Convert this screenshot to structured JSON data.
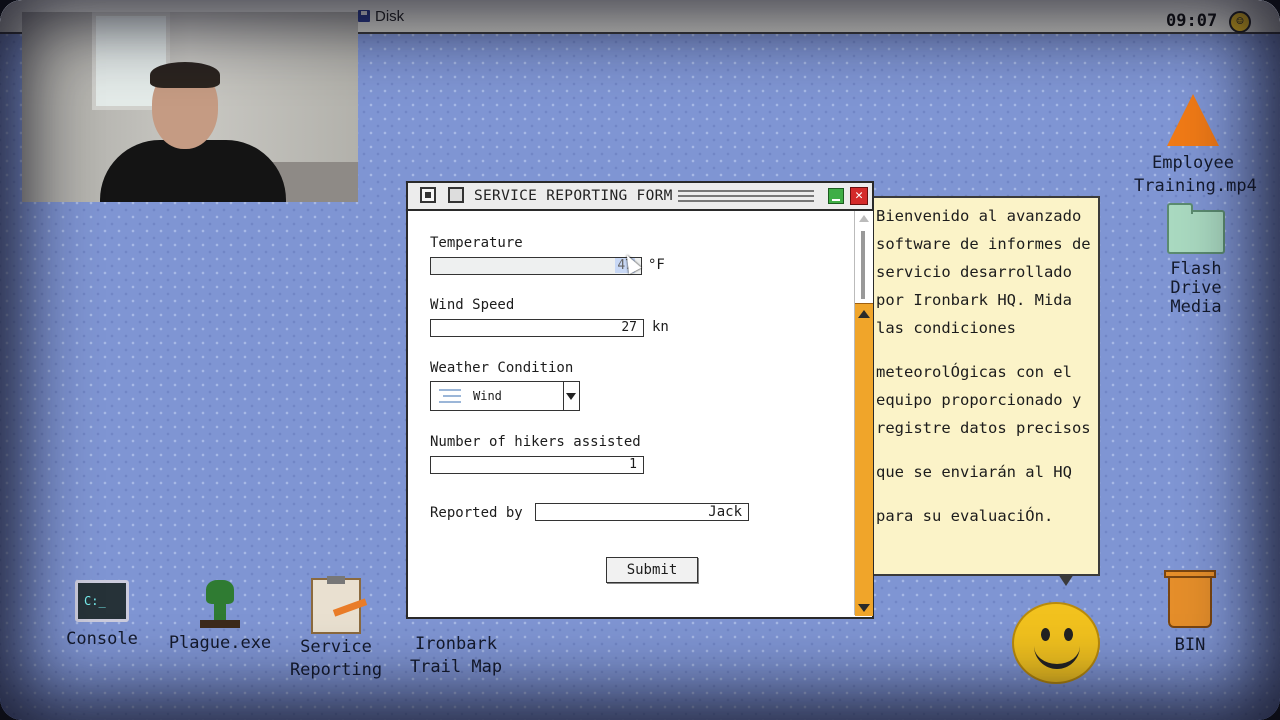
{
  "menubar": {
    "disk_label": "Disk",
    "clock": "09:07"
  },
  "desktop_icons": {
    "console": "Console",
    "plague": "Plague.exe",
    "service_reporting": [
      "Service",
      "Reporting"
    ],
    "trail_map": [
      "Ironbark",
      "Trail Map"
    ],
    "employee_training": [
      "Employee",
      "Training.mp4"
    ],
    "flash_drive": [
      "Flash Drive",
      "Media"
    ],
    "bin": "BIN"
  },
  "bubble": {
    "p1": "Bienvenido al avanzado software de informes de servicio desarrollado por Ironbark HQ. Mida las condiciones",
    "p2": "meteorolÓgicas con el equipo proporcionado y registre datos precisos",
    "p3": "que se enviarán al HQ",
    "p4": "para su evaluaciÓn."
  },
  "window": {
    "title": "SERVICE REPORTING FORM",
    "form": {
      "temperature_label": "Temperature",
      "temperature_value": "47",
      "temperature_unit": "°F",
      "wind_label": "Wind Speed",
      "wind_value": "27",
      "wind_unit": "kn",
      "weather_label": "Weather Condition",
      "weather_value": "Wind",
      "hikers_label": "Number of hikers assisted",
      "hikers_value": "1",
      "reported_label": "Reported by",
      "reported_value": "Jack",
      "submit_label": "Submit"
    }
  }
}
